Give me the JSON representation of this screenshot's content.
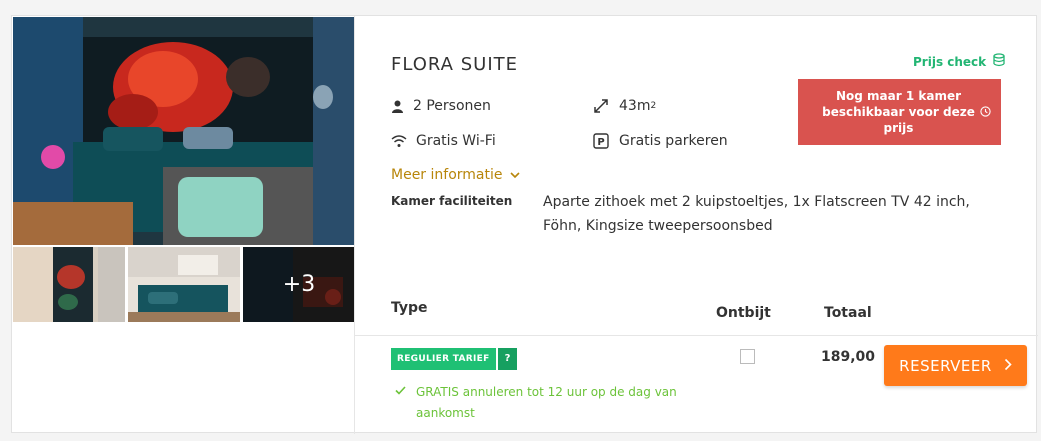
{
  "room": {
    "title": "FLORA SUITE",
    "features": {
      "persons": "2 Personen",
      "size": "43m",
      "size_sup": "2",
      "wifi": "Gratis Wi-Fi",
      "parking": "Gratis parkeren"
    },
    "more_info": "Meer informatie",
    "facilities_label": "Kamer faciliteiten",
    "facilities_value": "Aparte zithoek met 2 kuipstoeltjes, 1x Flatscreen TV 42 inch, Föhn, Kingsize tweepersoonsbed"
  },
  "gallery": {
    "more_count": "+3"
  },
  "price_check": "Prijs check",
  "availability_alert": "Nog maar 1 kamer beschikbaar voor deze prijs",
  "table": {
    "headers": {
      "type": "Type",
      "breakfast": "Ontbijt",
      "total": "Totaal"
    },
    "row": {
      "tariff_tag": "REGULIER TARIEF",
      "tariff_help": "?",
      "cancellation": "GRATIS annuleren tot 12 uur op de dag van aankomst",
      "breakfast_checked": false,
      "total": "189,00",
      "reserve_label": "RESERVEER"
    }
  },
  "colors": {
    "accent_green": "#22b573",
    "alert_red": "#d9534f",
    "reserve_orange": "#ff7a1a",
    "link_gold": "#b8860b"
  }
}
